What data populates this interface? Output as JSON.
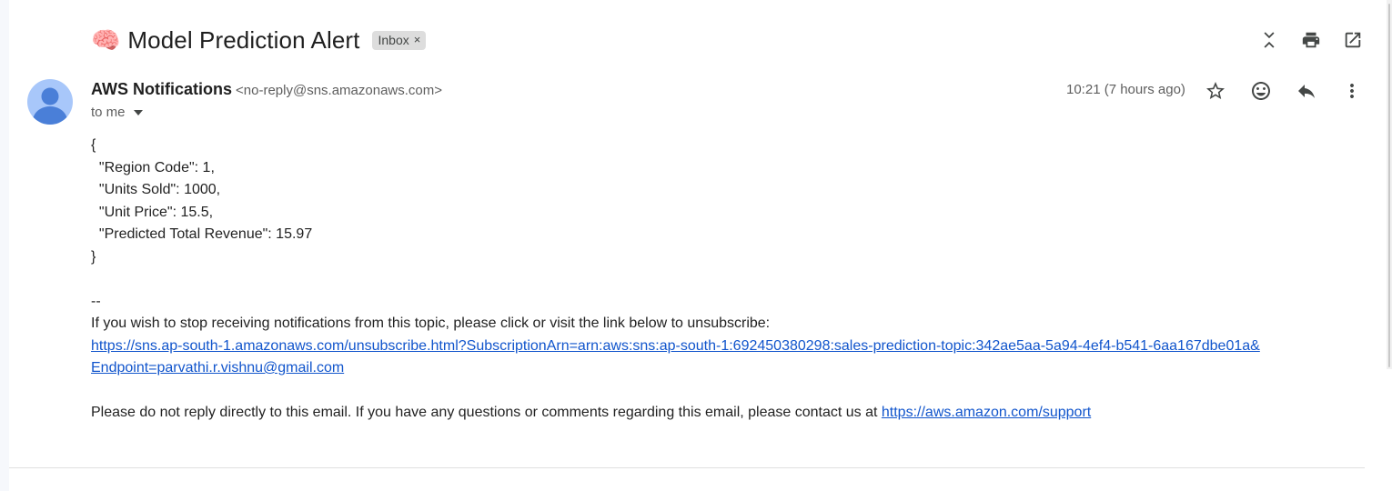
{
  "email": {
    "subject_emoji": "🧠",
    "subject": "Model Prediction Alert",
    "label_chip": "Inbox",
    "label_chip_remove": "×",
    "sender_name": "AWS Notifications",
    "sender_email": "<no-reply@sns.amazonaws.com>",
    "recipient": "to me",
    "time": "10:21 (7 hours ago)",
    "body_json_lines": [
      "{",
      "  \"Region Code\": 1,",
      "  \"Units Sold\": 1000,",
      "  \"Unit Price\": 15.5,",
      "  \"Predicted Total Revenue\": 15.97",
      "}"
    ],
    "signature_sep": "--",
    "unsubscribe_text": "If you wish to stop receiving notifications from this topic, please click or visit the link below to unsubscribe:",
    "unsubscribe_link_line1": "https://sns.ap-south-1.amazonaws.com/unsubscribe.html?SubscriptionArn=arn:aws:sns:ap-south-1:692450380298:sales-prediction-topic:342ae5aa-5a94-4ef4-b541-6aa167dbe01a&",
    "unsubscribe_link_line2": "Endpoint=parvathi.r.vishnu@gmail.com",
    "footer_text": "Please do not reply directly to this email. If you have any questions or comments regarding this email, please contact us at ",
    "support_link": "https://aws.amazon.com/support"
  },
  "icons": {
    "top": [
      "collapse-all-icon",
      "print-icon",
      "open-in-new-window-icon"
    ],
    "message": [
      "star-icon",
      "emoji-icon",
      "reply-icon",
      "more-vert-icon"
    ]
  },
  "colors": {
    "link": "#1155cc",
    "avatar_bg": "#a8c7fa",
    "avatar_fg": "#4a7fd8",
    "chip_bg": "#dddddd"
  }
}
